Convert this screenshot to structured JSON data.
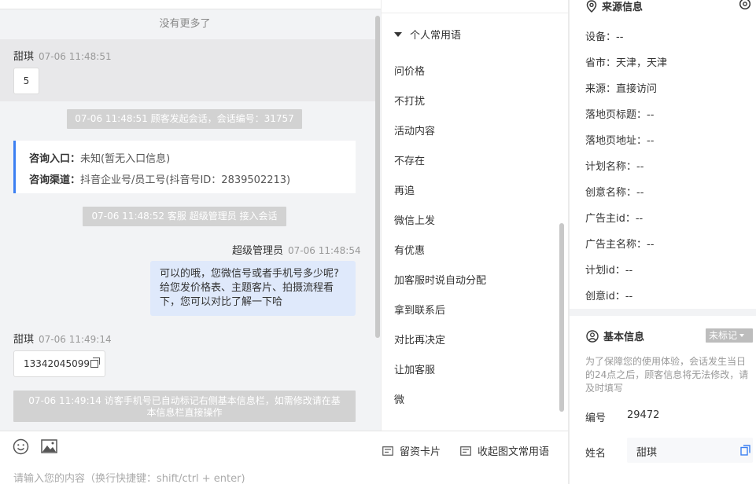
{
  "chat": {
    "no_more": "没有更多了",
    "messages": {
      "m1_sender": "甜琪",
      "m1_time": "07-06 11:48:51",
      "m1_text": "5",
      "sys1": "07-06 11:48:51 顾客发起会话，会话编号：31757",
      "entry_label": "咨询入口：",
      "entry_value": "未知(暂无入口信息)",
      "channel_label": "咨询渠道：",
      "channel_value": "抖音企业号/员工号(抖音号ID：2839502213)",
      "sys2": "07-06 11:48:52 客服 超级管理员 接入会话",
      "m2_sender": "超级管理员",
      "m2_time": "07-06 11:48:54",
      "m2_text_1": "可以的哦，您微信号或者手机号多少呢?",
      "m2_text_2": "给您发价格表、主题客片、拍摄流程看",
      "m2_text_3": "下，您可以对比了解一下哈",
      "m3_sender": "甜琪",
      "m3_time": "07-06 11:49:14",
      "m3_text": "13342045099",
      "sys3_1": "07-06 11:49:14 访客手机号已自动标记右侧基本信息栏，如需修改请在基",
      "sys3_2": "本信息栏直接操作"
    }
  },
  "input": {
    "placeholder": "请输入您的内容（换行快捷键：shift/ctrl + enter)",
    "card_label": "留资卡片",
    "collapse_label": "收起图文常用语"
  },
  "phrases": {
    "header": "个人常用语",
    "items": [
      "问价格",
      "不打扰",
      "活动内容",
      "不存在",
      "再追",
      "微信上发",
      "有优惠",
      "加客服时说自动分配",
      "拿到联系后",
      "对比再决定",
      "让加客服",
      "微"
    ]
  },
  "source_info": {
    "title": "来源信息",
    "fields": [
      "设备：--",
      "省市：天津，天津",
      "来源：直接访问",
      "落地页标题：--",
      "落地页地址：--",
      "计划名称：--",
      "创意名称：--",
      "广告主id：--",
      "广告主名称：--",
      "计划id：--",
      "创意id：--"
    ]
  },
  "basic_info": {
    "title": "基本信息",
    "tag": "未标记",
    "notice": "为了保障您的使用体验，会话发生当日的24点之后，顾客信息将无法修改，请及时填写",
    "id_label": "编号",
    "id_value": "29472",
    "name_label": "姓名",
    "name_value": "甜琪"
  },
  "colors": {
    "accent": "#3b7ff2",
    "bubble_blue": "#dfe9fb",
    "system_pill": "#d2d2d2"
  }
}
